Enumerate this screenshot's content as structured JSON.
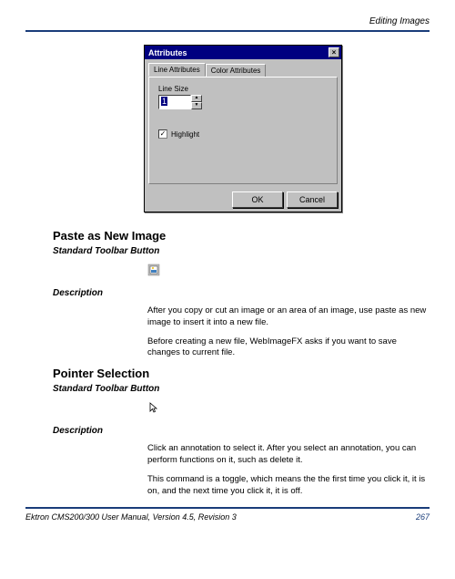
{
  "header": {
    "section": "Editing Images"
  },
  "dialog": {
    "title": "Attributes",
    "tabs": {
      "active": "Line Attributes",
      "inactive": "Color Attributes"
    },
    "linesize_label": "Line Size",
    "linesize_value": "1",
    "highlight_label": "Highlight",
    "ok": "OK",
    "cancel": "Cancel"
  },
  "section1": {
    "title": "Paste as New Image",
    "subtitle": "Standard Toolbar Button",
    "desc_label": "Description",
    "para1": "After you copy or cut an image or an area of an image, use paste as new image to insert it into a new file.",
    "para2": "Before creating a new file, WebImageFX asks if you want to save changes to current file."
  },
  "section2": {
    "title": "Pointer Selection",
    "subtitle": "Standard Toolbar Button",
    "desc_label": "Description",
    "para1": "Click an annotation to select it. After you select an annotation, you can perform functions on it, such as delete it.",
    "para2": "This command is a toggle, which means the the first time you click it, it is on, and the next time you click it, it is off."
  },
  "footer": {
    "text": "Ektron CMS200/300 User Manual, Version 4.5, Revision 3",
    "page": "267"
  }
}
